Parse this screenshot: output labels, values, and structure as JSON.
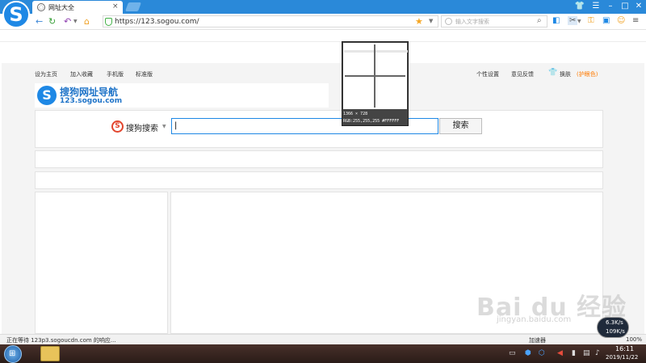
{
  "browser": {
    "tab_title": "网址大全",
    "tab_close": "×",
    "url": "https://123.sogou.com/",
    "search_placeholder": "输入文字搜索"
  },
  "page": {
    "top_links_left": [
      "设为主页",
      "加入收藏",
      "手机版",
      "标准版"
    ],
    "top_links_right": [
      "个性设置",
      "意见反馈"
    ],
    "skin_label": "换肤",
    "eye_label": "(护眼色)",
    "brand_name": "搜狗网址导航",
    "brand_domain": "123.sogou.com",
    "search_engine_label": "搜狗搜索",
    "search_input_value": "|",
    "search_button": "搜索"
  },
  "magnifier": {
    "size_readout": "1366 × 728",
    "color_readout": "RGB:255,255,255 #FFFFFF"
  },
  "status": {
    "loading_text": "正在等待 123p3.sogoucdn.com 的响应...",
    "zoom": "100%",
    "speed_up": "6.3K/s",
    "speed_down": "109K/s",
    "accelerate_label": "加速器"
  },
  "taskbar": {
    "time": "16:11",
    "date": "2019/11/22"
  },
  "watermark": {
    "text": "Bai du 经验",
    "sub": "jingyan.baidu.com"
  },
  "colors": {
    "titlebar": "#2a89d9",
    "accent": "#1e88e5",
    "link_orange": "#ff7a00"
  }
}
